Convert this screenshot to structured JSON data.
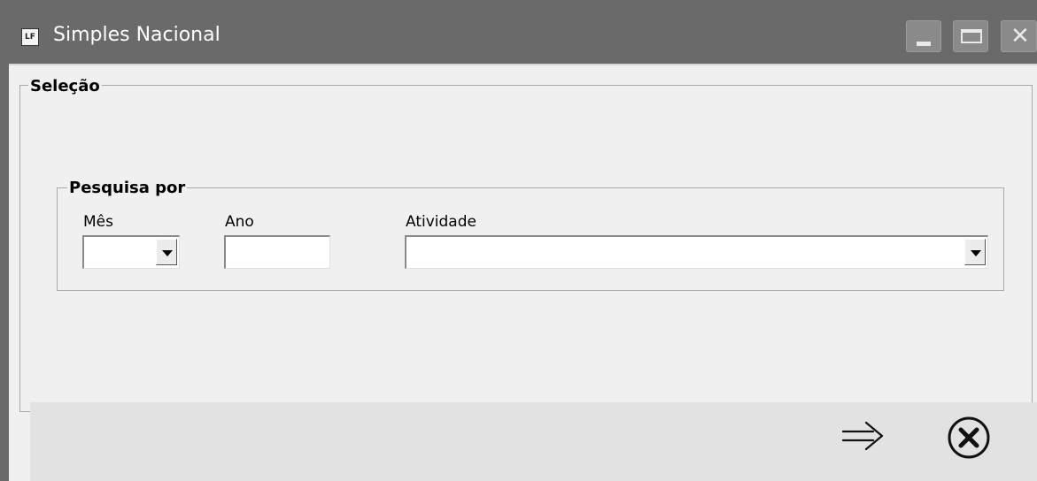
{
  "window": {
    "title": "Simples Nacional",
    "app_icon_text": "LF"
  },
  "selecao": {
    "legend": "Seleção"
  },
  "pesquisa": {
    "legend": "Pesquisa por",
    "mes": {
      "label": "Mês",
      "value": ""
    },
    "ano": {
      "label": "Ano",
      "value": ""
    },
    "atividade": {
      "label": "Atividade",
      "value": ""
    }
  },
  "footer": {
    "ok_icon": "arrow-right-icon",
    "close_icon": "close-circle-icon"
  }
}
